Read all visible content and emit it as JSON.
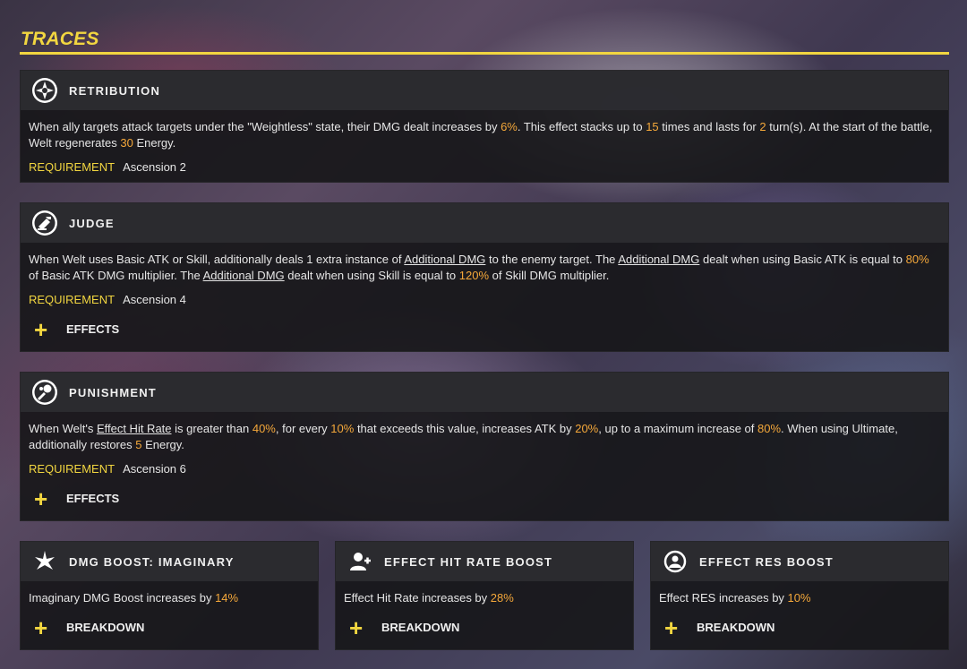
{
  "page": {
    "title": "TRACES"
  },
  "colors": {
    "accent": "#f2d640",
    "highlight": "#f5a83a"
  },
  "traces": [
    {
      "name": "RETRIBUTION",
      "icon": "retribution-icon",
      "desc": [
        "When ally targets attack targets under the \"Weightless\" state, their DMG dealt increases by ",
        "6%",
        ". This effect stacks up to ",
        "15",
        " times and lasts for ",
        "2",
        " turn(s). At the start of the battle, Welt regenerates ",
        "30",
        " Energy."
      ],
      "requirement_label": "REQUIREMENT",
      "requirement_value": "Ascension 2"
    },
    {
      "name": "JUDGE",
      "icon": "judge-icon",
      "desc": [
        "When Welt uses Basic ATK or Skill, additionally deals 1 extra instance of ",
        "Additional DMG",
        " to the enemy target. The ",
        "Additional DMG",
        " dealt when using Basic ATK is equal to ",
        "80%",
        " of Basic ATK DMG multiplier. The ",
        "Additional DMG",
        " dealt when using Skill is equal to ",
        "120%",
        " of Skill DMG multiplier."
      ],
      "requirement_label": "REQUIREMENT",
      "requirement_value": "Ascension 4",
      "expander_label": "EFFECTS"
    },
    {
      "name": "PUNISHMENT",
      "icon": "punishment-icon",
      "desc": [
        "When Welt's ",
        "Effect Hit Rate",
        " is greater than ",
        "40%",
        ", for every ",
        "10%",
        " that exceeds this value, increases ATK by ",
        "20%",
        ", up to a maximum increase of ",
        "80%",
        ". When using Ultimate, additionally restores ",
        "5",
        " Energy."
      ],
      "requirement_label": "REQUIREMENT",
      "requirement_value": "Ascension 6",
      "expander_label": "EFFECTS"
    }
  ],
  "stat_boosts": [
    {
      "name": "DMG BOOST: IMAGINARY",
      "icon": "imaginary-icon",
      "desc": "Imaginary DMG Boost increases by ",
      "value": "14%",
      "expander_label": "BREAKDOWN"
    },
    {
      "name": "EFFECT HIT RATE BOOST",
      "icon": "effect-hit-rate-icon",
      "desc": "Effect Hit Rate increases by ",
      "value": "28%",
      "expander_label": "BREAKDOWN"
    },
    {
      "name": "EFFECT RES BOOST",
      "icon": "effect-res-icon",
      "desc": "Effect RES increases by ",
      "value": "10%",
      "expander_label": "BREAKDOWN"
    }
  ]
}
